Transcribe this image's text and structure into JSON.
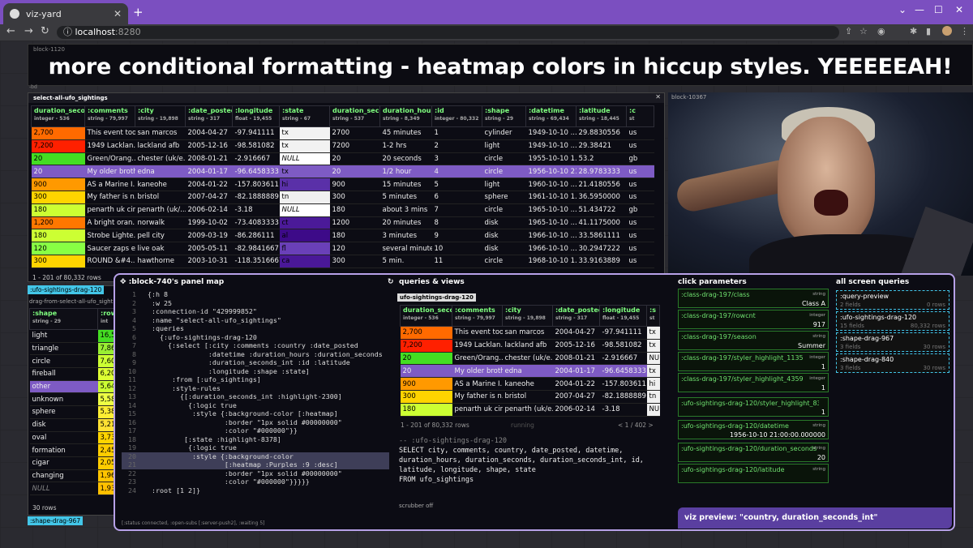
{
  "browser": {
    "tab_title": "viz-yard",
    "host": "localhost",
    "port": ":8280"
  },
  "banner": {
    "block": "block-1120",
    "title": "more conditional formatting - heatmap colors in hiccup styles. YEEEEEAH!"
  },
  "main_table": {
    "label": "select-all-ufo_sightings",
    "side_label": "-bd",
    "columns": [
      {
        "n": "duration_seco..",
        "t": "integer - 536"
      },
      {
        "n": ":comments",
        "t": "string - 79,997"
      },
      {
        "n": ":city",
        "t": "string - 19,898"
      },
      {
        "n": ":date_posted",
        "t": "string - 317"
      },
      {
        "n": ":longitude",
        "t": "float - 19,455"
      },
      {
        "n": ":state",
        "t": "string - 67"
      },
      {
        "n": "duration_seco..",
        "t": "string - 537"
      },
      {
        "n": "duration_hour..",
        "t": "string - 8,349"
      },
      {
        "n": ":id",
        "t": "integer - 80,332"
      },
      {
        "n": ":shape",
        "t": "string - 29"
      },
      {
        "n": ":datetime",
        "t": "string - 69,434"
      },
      {
        "n": ":latitude",
        "t": "string - 18,445"
      },
      {
        "n": ":c",
        "t": "st"
      }
    ],
    "rows": [
      [
        "2,700",
        "This event too...",
        "san marcos",
        "2004-04-27",
        "-97.941111",
        "tx",
        "2700",
        "45 minutes",
        "1",
        "cylinder",
        "1949-10-10 ...",
        "29.8830556",
        "us"
      ],
      [
        "7,200",
        "1949 Lacklan...",
        "lackland afb",
        "2005-12-16",
        "-98.581082",
        "tx",
        "7200",
        "1-2 hrs",
        "2",
        "light",
        "1949-10-10 ...",
        "29.38421",
        "us"
      ],
      [
        "20",
        "Green/Orang...",
        "chester (uk/e...",
        "2008-01-21",
        "-2.916667",
        "NULL",
        "20",
        "20 seconds",
        "3",
        "circle",
        "1955-10-10 1...",
        "53.2",
        "gb"
      ],
      [
        "20",
        "My older brother...",
        "edna",
        "2004-01-17",
        "-96.6458333",
        "tx",
        "20",
        "1/2 hour",
        "4",
        "circle",
        "1956-10-10 21:0...",
        "28.9783333",
        "us"
      ],
      [
        "900",
        "AS a Marine I...",
        "kaneohe",
        "2004-01-22",
        "-157.803611",
        "hi",
        "900",
        "15 minutes",
        "5",
        "light",
        "1960-10-10 ...",
        "21.4180556",
        "us"
      ],
      [
        "300",
        "My father is n...",
        "bristol",
        "2007-04-27",
        "-82.1888889",
        "tn",
        "300",
        "5 minutes",
        "6",
        "sphere",
        "1961-10-10 1...",
        "36.5950000",
        "us"
      ],
      [
        "180",
        "penarth uk cir...",
        "penarth (uk/...",
        "2006-02-14",
        "-3.18",
        "NULL",
        "180",
        "about 3 mins",
        "7",
        "circle",
        "1965-10-10 ...",
        "51.434722",
        "gb"
      ],
      [
        "1,200",
        "A bright oran...",
        "norwalk",
        "1999-10-02",
        "-73.4083333",
        "ct",
        "1200",
        "20 minutes",
        "8",
        "disk",
        "1965-10-10 ...",
        "41.1175000",
        "us"
      ],
      [
        "180",
        "Strobe Lighte...",
        "pell city",
        "2009-03-19",
        "-86.286111",
        "al",
        "180",
        "3 minutes",
        "9",
        "disk",
        "1966-10-10 ...",
        "33.5861111",
        "us"
      ],
      [
        "120",
        "Saucer zaps e...",
        "live oak",
        "2005-05-11",
        "-82.9841667",
        "fl",
        "120",
        "several minutes",
        "10",
        "disk",
        "1966-10-10 ...",
        "30.2947222",
        "us"
      ],
      [
        "300",
        "ROUND &#4...",
        "hawthorne",
        "2003-10-31",
        "-118.3516667",
        "ca",
        "300",
        "5 min.",
        "11",
        "circle",
        "1968-10-10 1...",
        "33.9163889",
        "us"
      ]
    ],
    "heat_colors": [
      "#ff6a00",
      "#ff2000",
      "#44dd22",
      "#a066ff",
      "#ff9900",
      "#ffd400",
      "#ccff33",
      "#ff7700",
      "#ccff33",
      "#88ff44",
      "#ffd400"
    ],
    "state_colors": [
      "#f2f2f2",
      "#f2f2f2",
      "#ffffff",
      "#7e5bc4",
      "#5a30a8",
      "#f0f0f0",
      "#ffffff",
      "#4b1a98",
      "#3d0a88",
      "#6a40b8",
      "#4a1898"
    ],
    "row_count": "1 - 201 of 80,332 rows"
  },
  "photo": {
    "label": "block-10367"
  },
  "left": {
    "tag1": ":ufo-sightings-drag-120",
    "tag2": "drag-from-select-all-ufo_sightings",
    "columns": [
      {
        "n": ":shape",
        "t": "string - 29"
      },
      {
        "n": ":row",
        "t": "int"
      }
    ],
    "rows": [
      [
        "light",
        "16,5"
      ],
      [
        "triangle",
        "7,86"
      ],
      [
        "circle",
        "7,60"
      ],
      [
        "fireball",
        "6,20"
      ],
      [
        "other",
        "5,64"
      ],
      [
        "unknown",
        "5,58"
      ],
      [
        "sphere",
        "5,38"
      ],
      [
        "disk",
        "5,21"
      ],
      [
        "oval",
        "3,73"
      ],
      [
        "formation",
        "2,45"
      ],
      [
        "cigar",
        "2,05"
      ],
      [
        "changing",
        "1,96"
      ],
      [
        "NULL",
        "1,93"
      ]
    ],
    "count": "30 rows",
    "tag3": ":shape-drag-967"
  },
  "panel": {
    "title": ":block-740's panel map",
    "code": [
      "{:h 8",
      " :w 25",
      " :connection-id \"429999852\"",
      " :name \"select-all-ufo_sightings\"",
      " :queries",
      "   {:ufo-sightings-drag-120",
      "     {:select [:city :comments :country :date_posted",
      "               :datetime :duration_hours :duration_seconds",
      "               :duration_seconds_int :id :latitude",
      "               :longitude :shape :state]",
      "      :from [:ufo_sightings]",
      "      :style-rules",
      "        {[:duration_seconds_int :highlight-2300]",
      "          {:logic true",
      "           :style {:background-color [:heatmap]",
      "                   :border \"1px solid #00000000\"",
      "                   :color \"#000000\"}}",
      "         [:state :highlight-8378]",
      "          {:logic true",
      "           :style {:background-color",
      "                   [:heatmap :Purples :9 :desc]",
      "                   :border \"1px solid #00000000\"",
      "                   :color \"#000000\"}}}}}",
      " :root [1 2]}"
    ],
    "status": "[:status connected, :open-subs [:server-push2], :waiting 5]"
  },
  "queries": {
    "title": "queries & views",
    "tab": "ufo-sightings-drag-120",
    "columns": [
      {
        "n": "duration_seco..",
        "t": "integer - 536"
      },
      {
        "n": ":comments",
        "t": "string - 79,997"
      },
      {
        "n": ":city",
        "t": "string - 19,898"
      },
      {
        "n": ":date_posted",
        "t": "string - 317"
      },
      {
        "n": ":longitude",
        "t": "float - 19,455"
      },
      {
        "n": ":s",
        "t": "st"
      }
    ],
    "rows": [
      [
        "2,700",
        "This event too...",
        "san marcos",
        "2004-04-27",
        "-97.941111",
        "tx"
      ],
      [
        "7,200",
        "1949 Lacklan...",
        "lackland afb",
        "2005-12-16",
        "-98.581082",
        "tx"
      ],
      [
        "20",
        "Green/Orang...",
        "chester (uk/e...",
        "2008-01-21",
        "-2.916667",
        "NU"
      ],
      [
        "20",
        "My older brother",
        "edna",
        "2004-01-17",
        "-96.6458333",
        "tx"
      ],
      [
        "900",
        "AS a Marine I...",
        "kaneohe",
        "2004-01-22",
        "-157.803611",
        "hi"
      ],
      [
        "300",
        "My father is n...",
        "bristol",
        "2007-04-27",
        "-82.1888889",
        "tn"
      ],
      [
        "180",
        "penarth uk cir...",
        "penarth (uk/e...",
        "2006-02-14",
        "-3.18",
        "NU"
      ]
    ],
    "heat_colors": [
      "#ff6a00",
      "#ff2000",
      "#44dd22",
      "#a066ff",
      "#ff9900",
      "#ffd400",
      "#ccff33"
    ],
    "count": "1 - 201 of 80,332 rows",
    "pager": "< 1 / 402 >",
    "running": "running",
    "sql": [
      "-- :ufo-sightings-drag-120",
      "SELECT city, comments, country, date_posted, datetime,",
      "duration_hours, duration_seconds, duration_seconds_int, id,",
      "latitude, longitude, shape, state",
      "FROM ufo_sightings"
    ],
    "scrubber": "scrubber off"
  },
  "click_params": {
    "title": "click parameters",
    "items": [
      {
        "k": ":class-drag-197/class",
        "t": "string",
        "v": "Class A"
      },
      {
        "k": ":class-drag-197/rowcnt",
        "t": "integer",
        "v": "917"
      },
      {
        "k": ":class-drag-197/season",
        "t": "string",
        "v": "Summer"
      },
      {
        "k": ":class-drag-197/styler_highlight_1135",
        "t": "integer",
        "v": "1"
      },
      {
        "k": ":class-drag-197/styler_highlight_4359",
        "t": "integer",
        "v": "1"
      },
      {
        "k": ":ufo-sightings-drag-120/styler_highlight_8378",
        "t": "",
        "v": "1"
      },
      {
        "k": ":ufo-sightings-drag-120/datetime",
        "t": "string",
        "v": "1956-10-10 21:00:00.000000"
      },
      {
        "k": ":ufo-sightings-drag-120/duration_seconds",
        "t": "string",
        "v": "20"
      },
      {
        "k": ":ufo-sightings-drag-120/latitude",
        "t": "string",
        "v": ""
      }
    ]
  },
  "screen_queries": {
    "title": "all screen queries",
    "items": [
      {
        "k": ":query-preview",
        "f": "2 fields",
        "r": "0 rows"
      },
      {
        "k": ":ufo-sightings-drag-120",
        "f": "15 fields",
        "r": "80,332 rows"
      },
      {
        "k": ":shape-drag-967",
        "f": "3 fields",
        "r": "30 rows"
      },
      {
        "k": ":shape-drag-840",
        "f": "3 fields",
        "r": "30 rows"
      }
    ]
  },
  "viz_preview": "viz preview: \"country, duration_seconds_int\""
}
